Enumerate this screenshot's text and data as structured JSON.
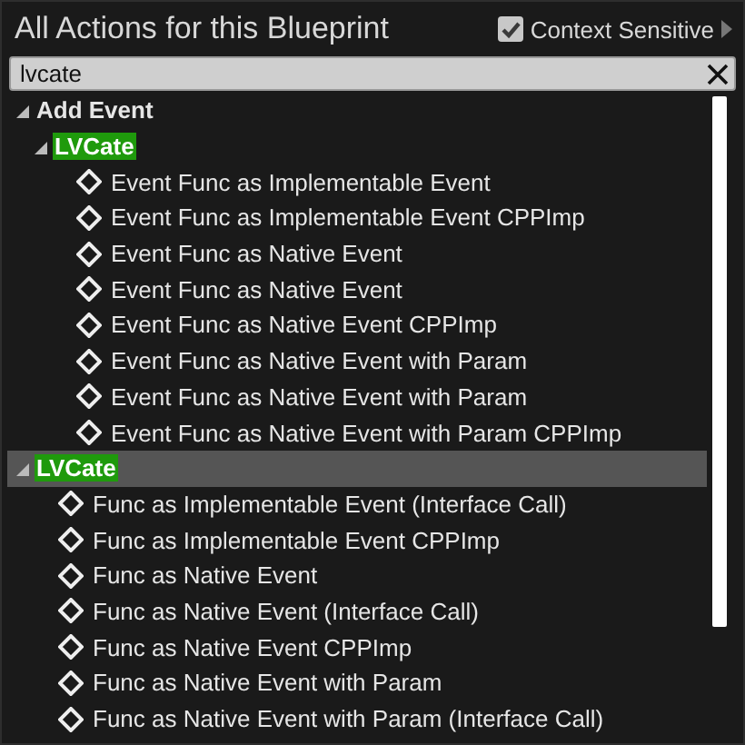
{
  "header": {
    "title": "All Actions for this Blueprint",
    "context_sensitive": {
      "label": "Context Sensitive",
      "checked": true
    }
  },
  "search": {
    "value": "lvcate"
  },
  "tree": [
    {
      "label": "Add Event",
      "kind": "category",
      "expanded": true,
      "selected": false,
      "highlighted": false,
      "children": [
        {
          "label": "LVCate",
          "kind": "category",
          "expanded": true,
          "selected": false,
          "highlighted": true,
          "children": [
            {
              "label": "Event Func as Implementable Event",
              "kind": "action",
              "selected": false
            },
            {
              "label": "Event Func as Implementable Event CPPImp",
              "kind": "action",
              "selected": false
            },
            {
              "label": "Event Func as Native Event",
              "kind": "action",
              "selected": false
            },
            {
              "label": "Event Func as Native Event",
              "kind": "action",
              "selected": false
            },
            {
              "label": "Event Func as Native Event CPPImp",
              "kind": "action",
              "selected": false
            },
            {
              "label": "Event Func as Native Event with Param",
              "kind": "action",
              "selected": false
            },
            {
              "label": "Event Func as Native Event with Param",
              "kind": "action",
              "selected": false
            },
            {
              "label": "Event Func as Native Event with Param CPPImp",
              "kind": "action",
              "selected": false
            }
          ]
        }
      ]
    },
    {
      "label": "LVCate",
      "kind": "category",
      "expanded": true,
      "selected": true,
      "highlighted": true,
      "children": [
        {
          "label": "Func as Implementable Event (Interface Call)",
          "kind": "action",
          "selected": false
        },
        {
          "label": "Func as Implementable Event CPPImp",
          "kind": "action",
          "selected": false
        },
        {
          "label": "Func as Native Event",
          "kind": "action",
          "selected": false
        },
        {
          "label": "Func as Native Event (Interface Call)",
          "kind": "action",
          "selected": false
        },
        {
          "label": "Func as Native Event CPPImp",
          "kind": "action",
          "selected": false
        },
        {
          "label": "Func as Native Event with Param",
          "kind": "action",
          "selected": false
        },
        {
          "label": "Func as Native Event with Param (Interface Call)",
          "kind": "action",
          "selected": false
        }
      ]
    }
  ]
}
